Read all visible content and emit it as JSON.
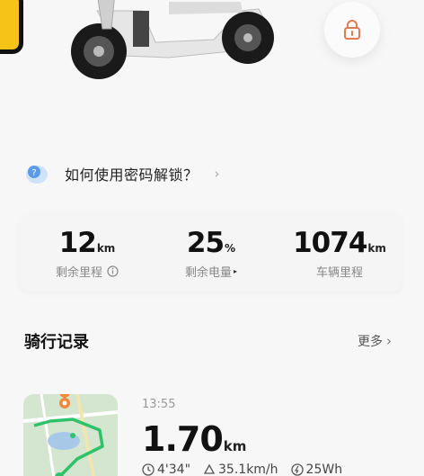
{
  "help": {
    "text": "如何使用密码解锁？",
    "chevron": "›"
  },
  "stats": [
    {
      "value": "12",
      "unit": "km",
      "label": "剩余里程",
      "extra": "info-icon"
    },
    {
      "value": "25",
      "unit": "%",
      "label": "剩余电量",
      "extra": "▸"
    },
    {
      "value": "1074",
      "unit": "km",
      "label": "车辆里程",
      "extra": ""
    }
  ],
  "records": {
    "title": "骑行记录",
    "more": "更多",
    "more_chevron": "›"
  },
  "ride": {
    "time": "13:55",
    "distance": "1.70",
    "distance_unit": "km",
    "duration": "4'34\"",
    "speed": "35.1km/h",
    "energy": "25Wh"
  },
  "colors": {
    "accent": "#e07b53",
    "background": "#f7f7f7",
    "yellow": "#f6c417"
  }
}
